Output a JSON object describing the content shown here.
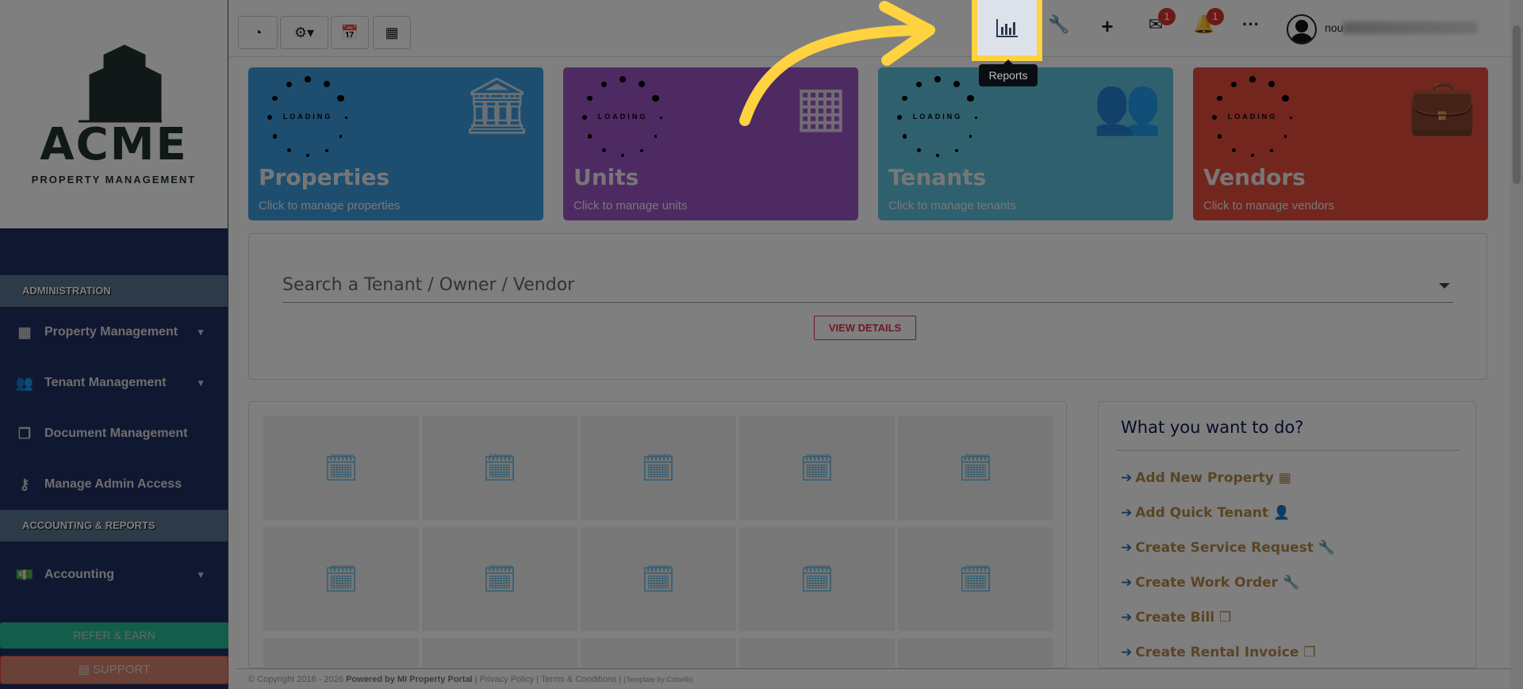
{
  "logo": {
    "name": "ACME",
    "tagline": "PROPERTY MANAGEMENT"
  },
  "sidebar": {
    "sections": [
      {
        "label": "ADMINISTRATION"
      },
      {
        "label": "ACCOUNTING & REPORTS"
      }
    ],
    "items": [
      {
        "label": "Property Management",
        "icon": "building-icon"
      },
      {
        "label": "Tenant Management",
        "icon": "users-icon"
      },
      {
        "label": "Document Management",
        "icon": "copy-icon"
      },
      {
        "label": "Manage Admin Access",
        "icon": "key-icon"
      },
      {
        "label": "Accounting",
        "icon": "money-icon"
      }
    ],
    "refer": "REFER & EARN",
    "support": "SUPPORT"
  },
  "topbar": {
    "tooltip": "Reports",
    "mail_count": "1",
    "notif_count": "1",
    "user": "nou"
  },
  "cards": [
    {
      "title": "Properties",
      "sub": "Click to manage properties",
      "color": "#3a9ce0"
    },
    {
      "title": "Units",
      "sub": "Click to manage units",
      "color": "#9c54c6"
    },
    {
      "title": "Tenants",
      "sub": "Click to manage tenants",
      "color": "#5ec0dc"
    },
    {
      "title": "Vendors",
      "sub": "Click to manage vendors",
      "color": "#e74c3c"
    }
  ],
  "loading": "LOADING",
  "search": {
    "placeholder": "Search a Tenant / Owner / Vendor",
    "button": "VIEW DETAILS"
  },
  "todo": {
    "title": "What you want to do?",
    "items": [
      "Add New Property",
      "Add Quick Tenant",
      "Create Service Request",
      "Create Work Order",
      "Create Bill",
      "Create Rental Invoice"
    ]
  },
  "footer": {
    "copyright": "© Copyright 2016 - 2026",
    "powered": "Powered by MI Property Portal",
    "privacy": "Privacy Policy",
    "terms": "Terms & Conditions",
    "template": "(Template by Colorlib)"
  }
}
